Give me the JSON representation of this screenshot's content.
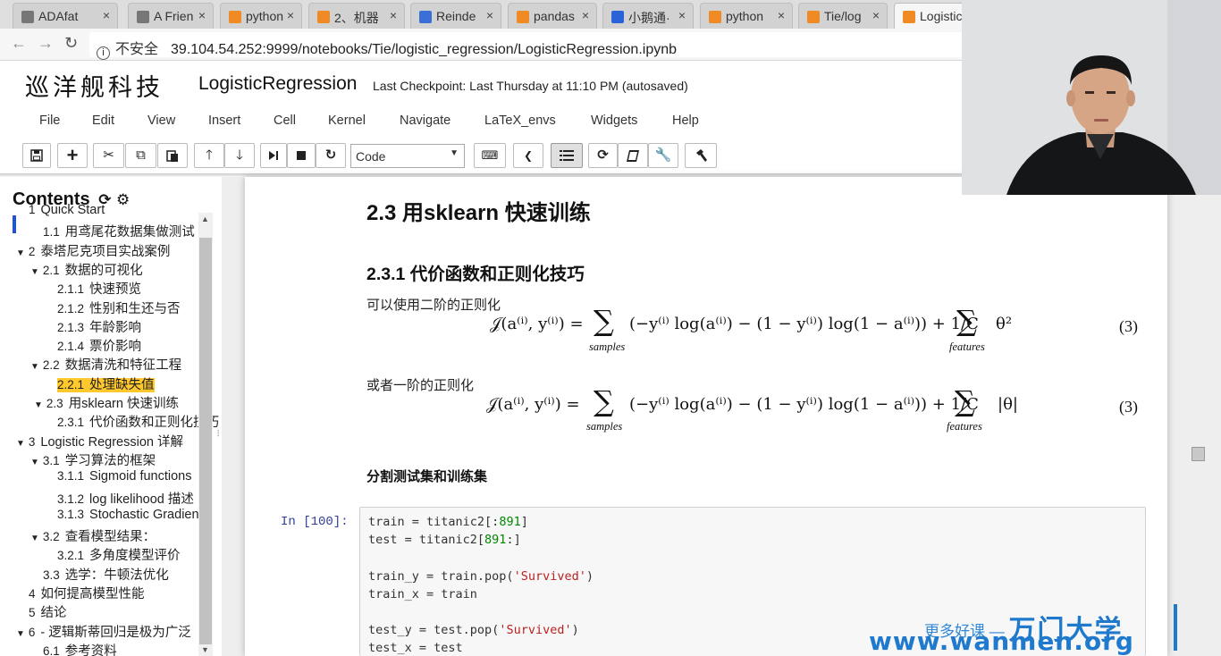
{
  "browser": {
    "tabs": [
      {
        "label": "ADAfat",
        "color": "#777777"
      },
      {
        "label": "A Frien",
        "color": "#777777"
      },
      {
        "label": "python",
        "color": "#f08a24"
      },
      {
        "label": "2、机器",
        "color": "#f08a24"
      },
      {
        "label": "Reinde",
        "color": "#3b6fd8"
      },
      {
        "label": "pandas",
        "color": "#f08a24"
      },
      {
        "label": "小鹅通·",
        "color": "#2a63d8"
      },
      {
        "label": "python",
        "color": "#f08a24"
      },
      {
        "label": "Tie/log",
        "color": "#f08a24"
      },
      {
        "label": "Logistic",
        "color": "#f08a24"
      }
    ],
    "security_label": "不安全",
    "url": "39.104.54.252:9999/notebooks/Tie/logistic_regression/LogisticRegression.ipynb"
  },
  "header": {
    "logo": "巡洋舰科技",
    "notebook_title": "LogisticRegression",
    "checkpoint": "Last Checkpoint: Last Thursday at 11:10 PM (autosaved)"
  },
  "menu": [
    "File",
    "Edit",
    "View",
    "Insert",
    "Cell",
    "Kernel",
    "Navigate",
    "LaTeX_envs",
    "Widgets",
    "Help"
  ],
  "toolbar": {
    "cell_type": "Code",
    "buttons": [
      "save-icon",
      "add-icon",
      "cut-icon",
      "copy-icon",
      "paste-icon",
      "move-up-icon",
      "move-down-icon",
      "run-icon",
      "stop-icon",
      "restart-icon",
      "keyboard-icon",
      "collapse-icon",
      "toc-icon",
      "refresh-icon",
      "book-icon",
      "wrench-icon",
      "hammer-icon"
    ]
  },
  "toc": {
    "title": "Contents",
    "items": [
      {
        "num": "1",
        "label": "Quick Start",
        "level": 0,
        "caret": false
      },
      {
        "num": "1.1",
        "label": "用鸢尾花数据集做测试",
        "level": 1,
        "caret": false
      },
      {
        "num": "2",
        "label": "泰塔尼克项目实战案例",
        "level": 0,
        "caret": true
      },
      {
        "num": "2.1",
        "label": "数据的可视化",
        "level": 1,
        "caret": true
      },
      {
        "num": "2.1.1",
        "label": "快速预览",
        "level": 2,
        "caret": false
      },
      {
        "num": "2.1.2",
        "label": "性别和生还与否",
        "level": 2,
        "caret": false
      },
      {
        "num": "2.1.3",
        "label": "年龄影响",
        "level": 2,
        "caret": false
      },
      {
        "num": "2.1.4",
        "label": "票价影响",
        "level": 2,
        "caret": false
      },
      {
        "num": "2.2",
        "label": "数据清洗和特征工程",
        "level": 1,
        "caret": true
      },
      {
        "num": "2.2.1",
        "label": "处理缺失值",
        "level": 2,
        "caret": false,
        "highlight": true
      },
      {
        "num": "2.3",
        "label": "用sklearn 快速训练",
        "level": 1,
        "caret": true,
        "current": true
      },
      {
        "num": "2.3.1",
        "label": "代价函数和正则化技巧",
        "level": 2,
        "caret": false
      },
      {
        "num": "3",
        "label": "Logistic Regression 详解",
        "level": 0,
        "caret": true
      },
      {
        "num": "3.1",
        "label": "学习算法的框架",
        "level": 1,
        "caret": true
      },
      {
        "num": "3.1.1",
        "label": "Sigmoid functions",
        "level": 2,
        "caret": false
      },
      {
        "num": "3.1.2",
        "label": "log likelihood 描述",
        "level": 2,
        "caret": false
      },
      {
        "num": "3.1.3",
        "label": "Stochastic Gradient",
        "level": 2,
        "caret": false
      },
      {
        "num": "3.2",
        "label": "查看模型结果：",
        "level": 1,
        "caret": true
      },
      {
        "num": "3.2.1",
        "label": "多角度模型评价",
        "level": 2,
        "caret": false
      },
      {
        "num": "3.3",
        "label": "选学：牛顿法优化",
        "level": 1,
        "caret": false
      },
      {
        "num": "4",
        "label": "如何提高模型性能",
        "level": 0,
        "caret": false
      },
      {
        "num": "5",
        "label": "结论",
        "level": 0,
        "caret": false
      },
      {
        "num": "6",
        "label": "- 逻辑斯蒂回归是极为广泛",
        "level": 0,
        "caret": true
      },
      {
        "num": "6.1",
        "label": "参考资料",
        "level": 1,
        "caret": false
      }
    ]
  },
  "notebook": {
    "h2": "2.3  用sklearn 快速训练",
    "h3": "2.3.1  代价函数和正则化技巧",
    "para1": "可以使用二阶的正则化",
    "para2": "或者一阶的正则化",
    "formula1_left": "𝒥(a⁽ⁱ⁾, y⁽ⁱ⁾) =",
    "formula1_body": "(−y⁽ⁱ⁾ log(a⁽ⁱ⁾) − (1 − y⁽ⁱ⁾) log(1 − a⁽ⁱ⁾)) + 1/C",
    "formula1_tail": "θ²",
    "formula2_tail": "|θ|",
    "sum_sub1": "samples",
    "sum_sub2": "features",
    "eq_num": "(3)",
    "h4": "分割测试集和训练集",
    "prompt": "In  [100]:",
    "code": [
      {
        "parts": [
          [
            "train = titanic2[:",
            "t"
          ],
          [
            "891",
            "n"
          ],
          [
            "]",
            "t"
          ]
        ]
      },
      {
        "parts": [
          [
            "test = titanic2[",
            "t"
          ],
          [
            "891",
            "n"
          ],
          [
            ":]",
            "t"
          ]
        ]
      },
      {
        "parts": [
          [
            "",
            "t"
          ]
        ]
      },
      {
        "parts": [
          [
            "train_y = train.pop(",
            "t"
          ],
          [
            "'Survived'",
            "s"
          ],
          [
            ")",
            "t"
          ]
        ]
      },
      {
        "parts": [
          [
            "train_x = train",
            "t"
          ]
        ]
      },
      {
        "parts": [
          [
            "",
            "t"
          ]
        ]
      },
      {
        "parts": [
          [
            "test_y = test.pop(",
            "t"
          ],
          [
            "'Survived'",
            "s"
          ],
          [
            ")",
            "t"
          ]
        ]
      },
      {
        "parts": [
          [
            "test_x = test",
            "t"
          ]
        ]
      }
    ]
  },
  "watermark": {
    "line1": "更多好课 —",
    "brand": "万门大学",
    "url": "www.wanmen.org"
  }
}
